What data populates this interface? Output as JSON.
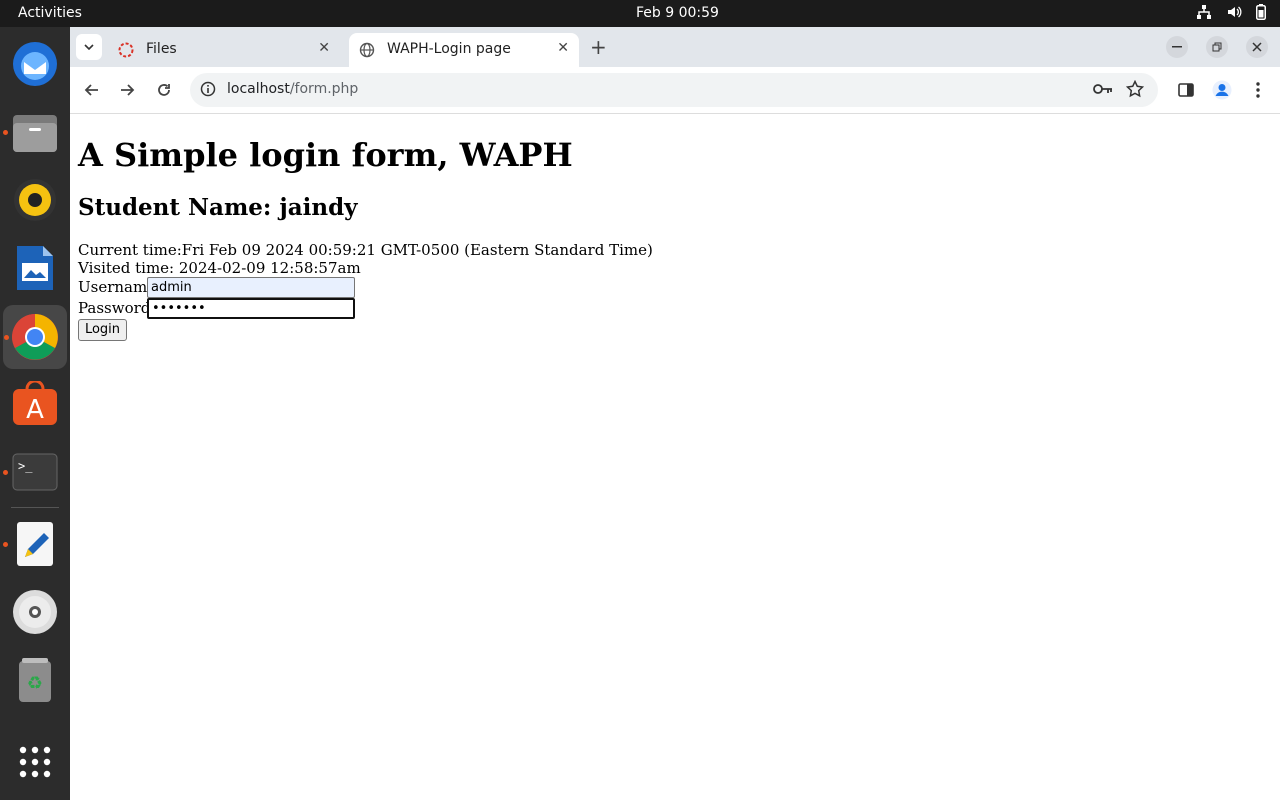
{
  "system": {
    "activities": "Activities",
    "clock": "Feb 9  00:59"
  },
  "dock": {
    "apps": [
      "thunderbird-icon",
      "files-icon",
      "rhythmbox-icon",
      "writer-icon",
      "chrome-icon",
      "app-center-icon",
      "terminal-icon",
      "text-editor-icon",
      "disc-icon",
      "trash-icon",
      "app-grid-icon"
    ]
  },
  "browser": {
    "tabs": [
      {
        "title": "Files",
        "active": false
      },
      {
        "title": "WAPH-Login page",
        "active": true
      }
    ],
    "url": {
      "host": "localhost",
      "path": "/form.php"
    }
  },
  "page": {
    "heading": "A Simple login form, WAPH",
    "subheading": "Student Name: jaindy",
    "current_time": "Current time:Fri Feb 09 2024 00:59:21 GMT-0500 (Eastern Standard Time)",
    "visited_time": "Visited time: 2024-02-09 12:58:57am",
    "username_label": "Username:",
    "username_value": "admin",
    "password_label": "Password:",
    "password_value": "•••••••",
    "login_label": "Login"
  },
  "colors": {
    "accent": "#e95420",
    "topbar": "#1b1b1b",
    "dock": "#2c2c2c",
    "tabbar": "#e2e6eb"
  }
}
